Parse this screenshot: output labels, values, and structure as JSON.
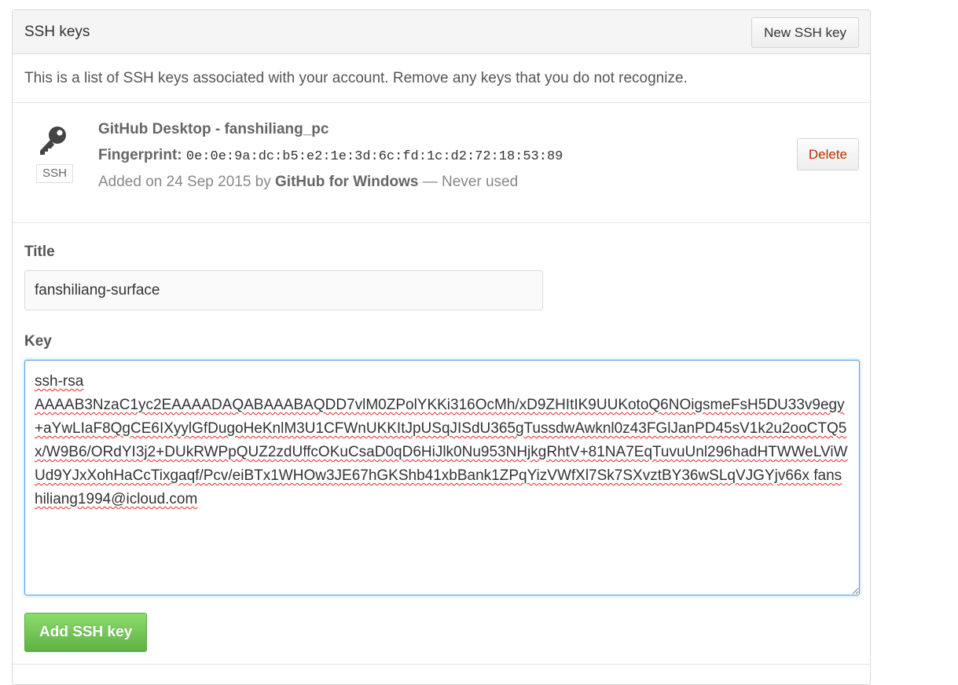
{
  "header": {
    "title": "SSH keys",
    "new_key_label": "New SSH key"
  },
  "intro": "This is a list of SSH keys associated with your account. Remove any keys that you do not recognize.",
  "keys": [
    {
      "icon": "key-icon",
      "badge": "SSH",
      "title": "GitHub Desktop - fanshiliang_pc",
      "fingerprint_label": "Fingerprint:",
      "fingerprint": "0e:0e:9a:dc:b5:e2:1e:3d:6c:fd:1c:d2:72:18:53:89",
      "added_prefix": "Added on 24 Sep 2015 by",
      "added_by": "GitHub for Windows",
      "added_suffix": "— Never used",
      "delete_label": "Delete"
    }
  ],
  "form": {
    "title_label": "Title",
    "title_value": "fanshiliang-surface",
    "key_label": "Key",
    "key_value": "ssh-rsa\nAAAAB3NzaC1yc2EAAAADAQABAAABAQDD7vlM0ZPolYKKi316OcMh/xD9ZHItIK9UUKotoQ6NOigsmeFsH5DU33v9egy+aYwLIaF8QgCE6IXyylGfDugoHeKnlM3U1CFWnUKKItJpUSqJISdU365gTussdwAwknl0z43FGlJanPD45sV1k2u2ooCTQ5x/W9B6/ORdYI3j2+DUkRWPpQUZ2zdUffcOKuCsaD0qD6HiJlk0Nu953NHjkgRhtV+81NA7EqTuvuUnl296hadHTWWeLViWUd9YJxXohHaCcTixgaqf/Pcv/eiBTx1WHOw3JE67hGKShb41xbBank1ZPqYizVWfXl7Sk7SXvztBY36wSLqVJGYjv66x fanshiliang1994@icloud.com\n",
    "submit_label": "Add SSH key"
  },
  "colors": {
    "success_green": "#60b044",
    "danger_red": "#bd2c00",
    "focus_blue": "#51a7e8"
  }
}
